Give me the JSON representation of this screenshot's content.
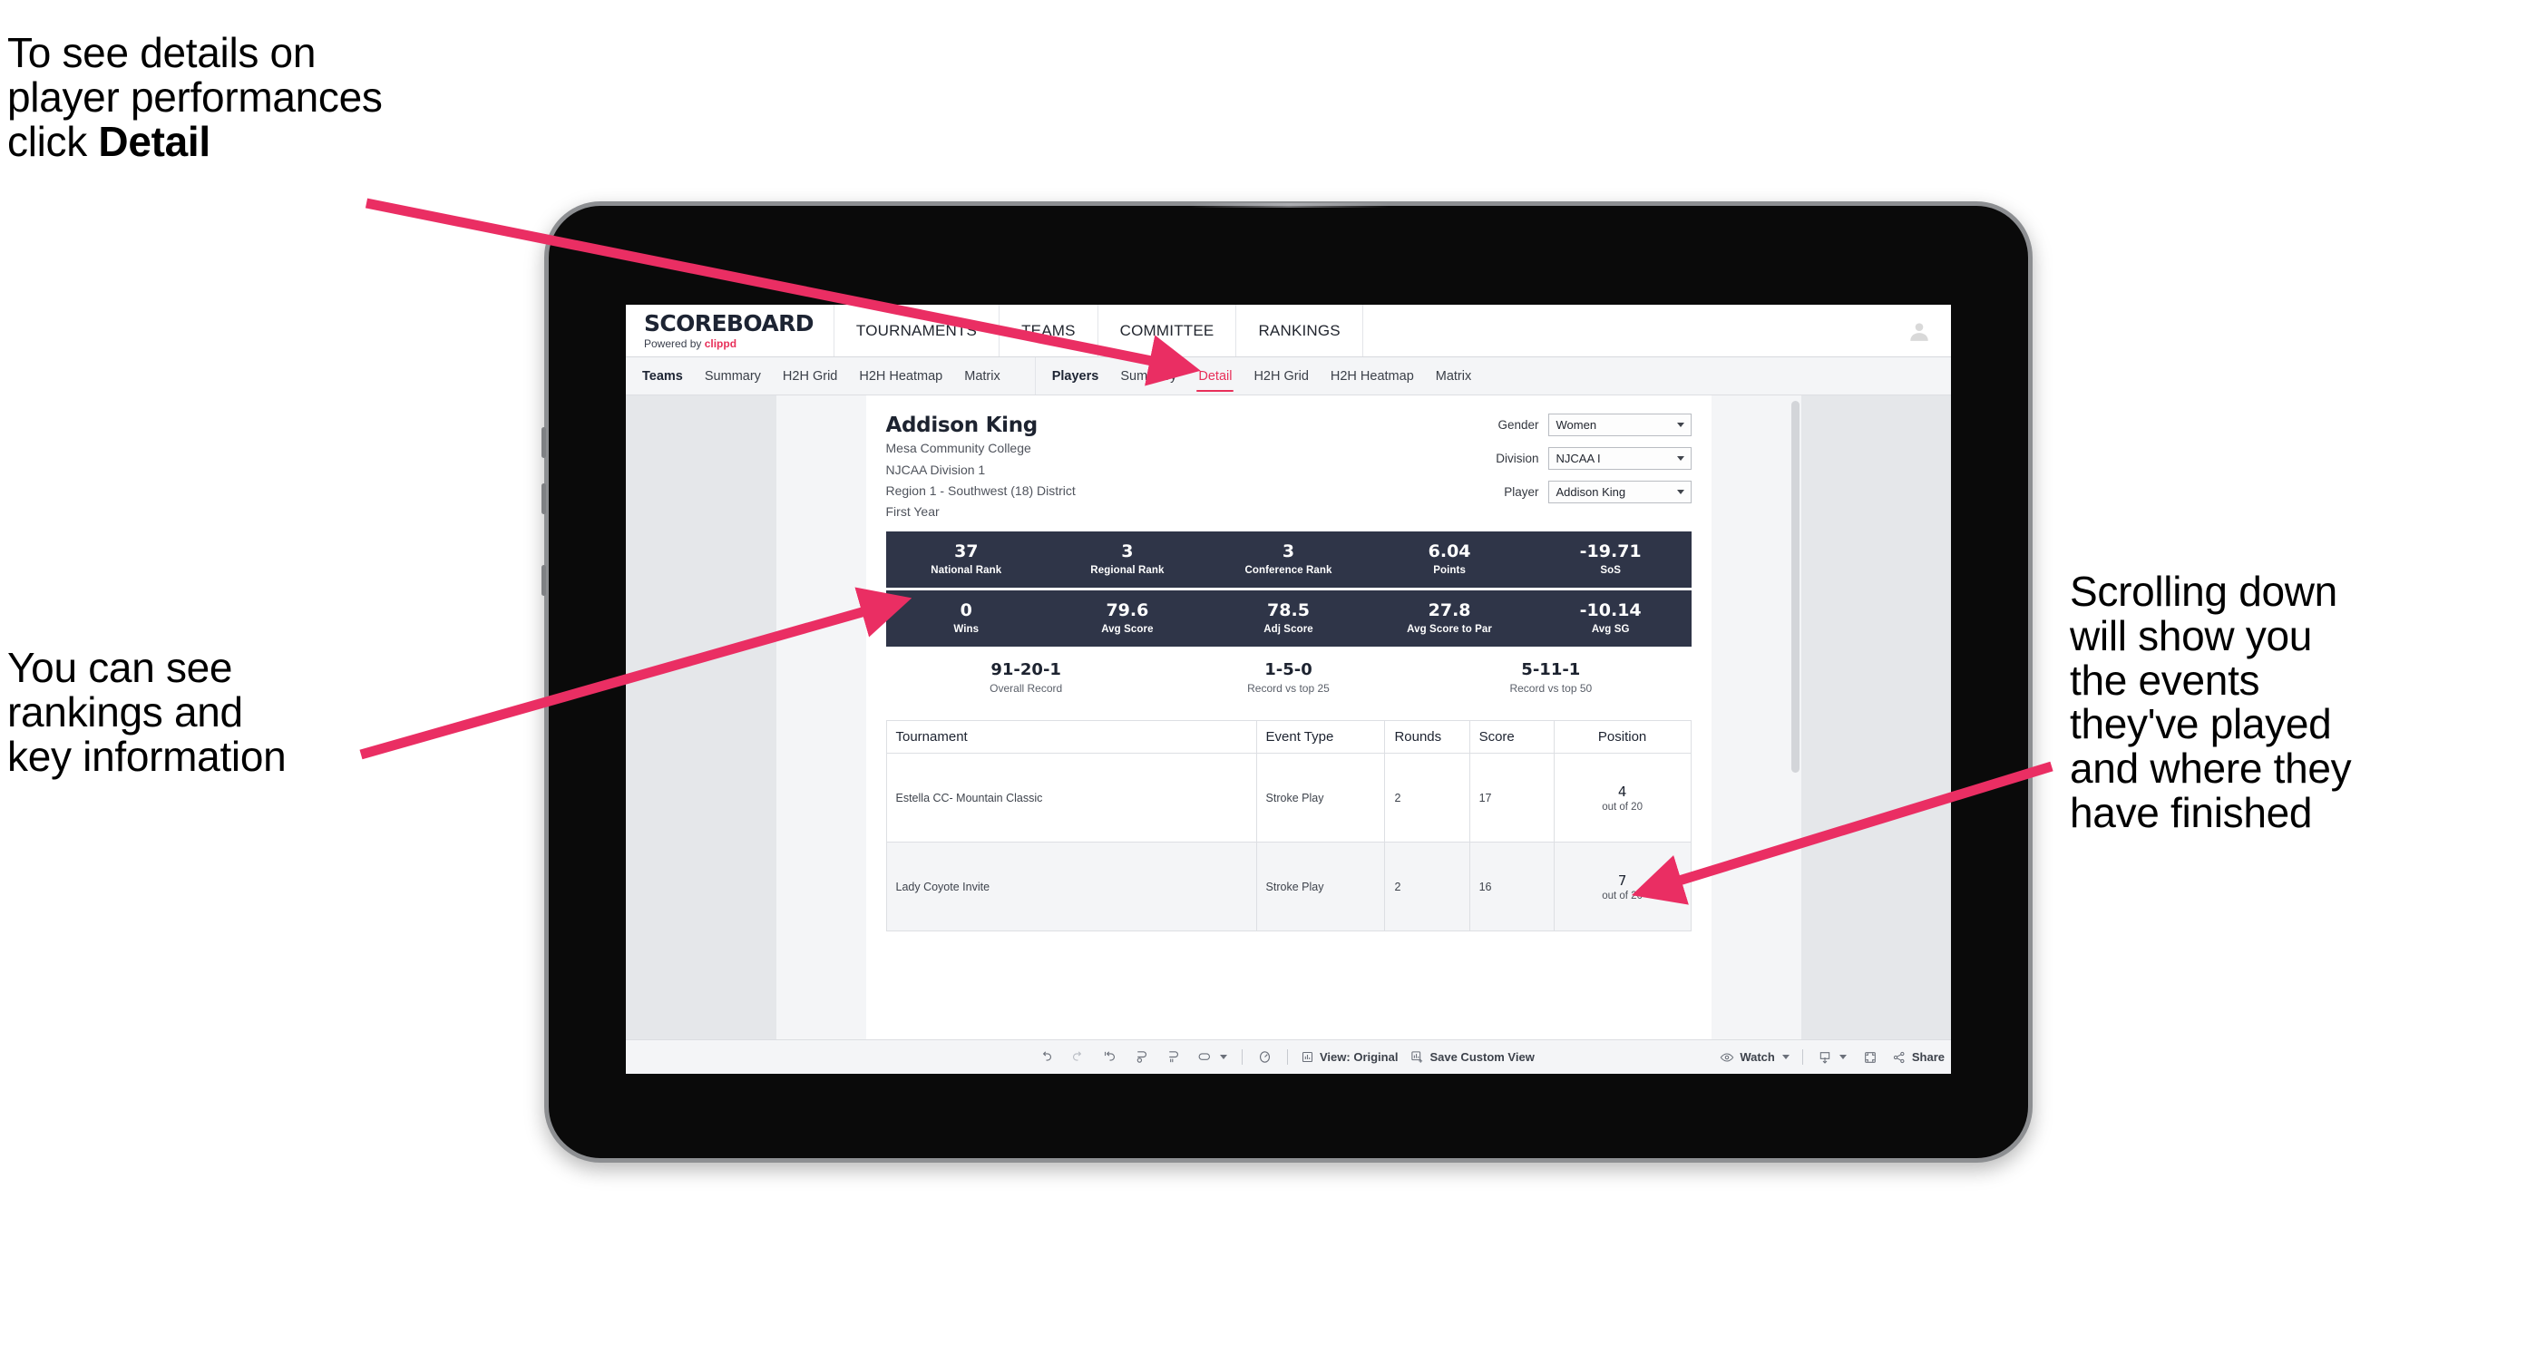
{
  "annotations": {
    "top_left": "To see details on\nplayer performances\nclick ",
    "top_left_bold": "Detail",
    "bottom_left": "You can see\nrankings and\nkey information",
    "right": "Scrolling down\nwill show you\nthe events\nthey've played\nand where they\nhave finished"
  },
  "colors": {
    "accent_pink": "#e8305a",
    "navy_band": "#2f3548",
    "workspace_gray": "#e5e7ea"
  },
  "app": {
    "brand": {
      "title": "SCOREBOARD",
      "powered_prefix": "Powered by ",
      "powered_name": "clippd"
    },
    "top_nav": [
      "TOURNAMENTS",
      "TEAMS",
      "COMMITTEE",
      "RANKINGS"
    ],
    "tab_groups": [
      {
        "lead": "Teams",
        "tabs": [
          "Summary",
          "H2H Grid",
          "H2H Heatmap",
          "Matrix"
        ],
        "active": null
      },
      {
        "lead": "Players",
        "tabs": [
          "Summary",
          "Detail",
          "H2H Grid",
          "H2H Heatmap",
          "Matrix"
        ],
        "active": "Detail"
      }
    ]
  },
  "player": {
    "name": "Addison King",
    "school": "Mesa Community College",
    "division": "NJCAA Division 1",
    "region": "Region 1 - Southwest (18) District",
    "year": "First Year"
  },
  "filters": [
    {
      "label": "Gender",
      "value": "Women"
    },
    {
      "label": "Division",
      "value": "NJCAA I"
    },
    {
      "label": "Player",
      "value": "Addison King"
    }
  ],
  "stats_band_1": [
    {
      "value": "37",
      "label": "National Rank"
    },
    {
      "value": "3",
      "label": "Regional Rank"
    },
    {
      "value": "3",
      "label": "Conference Rank"
    },
    {
      "value": "6.04",
      "label": "Points"
    },
    {
      "value": "-19.71",
      "label": "SoS"
    }
  ],
  "stats_band_2": [
    {
      "value": "0",
      "label": "Wins"
    },
    {
      "value": "79.6",
      "label": "Avg Score"
    },
    {
      "value": "78.5",
      "label": "Adj Score"
    },
    {
      "value": "27.8",
      "label": "Avg Score to Par"
    },
    {
      "value": "-10.14",
      "label": "Avg SG"
    }
  ],
  "records": [
    {
      "value": "91-20-1",
      "label": "Overall Record"
    },
    {
      "value": "1-5-0",
      "label": "Record vs top 25"
    },
    {
      "value": "5-11-1",
      "label": "Record vs top 50"
    }
  ],
  "events_table": {
    "columns": [
      "Tournament",
      "Event Type",
      "Rounds",
      "Score",
      "Position"
    ],
    "rows": [
      {
        "tournament": "Estella CC- Mountain Classic",
        "event_type": "Stroke Play",
        "rounds": "2",
        "score": "17",
        "position": "4",
        "out_of": "out of 20"
      },
      {
        "tournament": "Lady Coyote Invite",
        "event_type": "Stroke Play",
        "rounds": "2",
        "score": "16",
        "position": "7",
        "out_of": "out of 20"
      }
    ]
  },
  "bottom_toolbar": {
    "view_label": "View: Original",
    "save_label": "Save Custom View",
    "watch_label": "Watch",
    "share_label": "Share"
  }
}
